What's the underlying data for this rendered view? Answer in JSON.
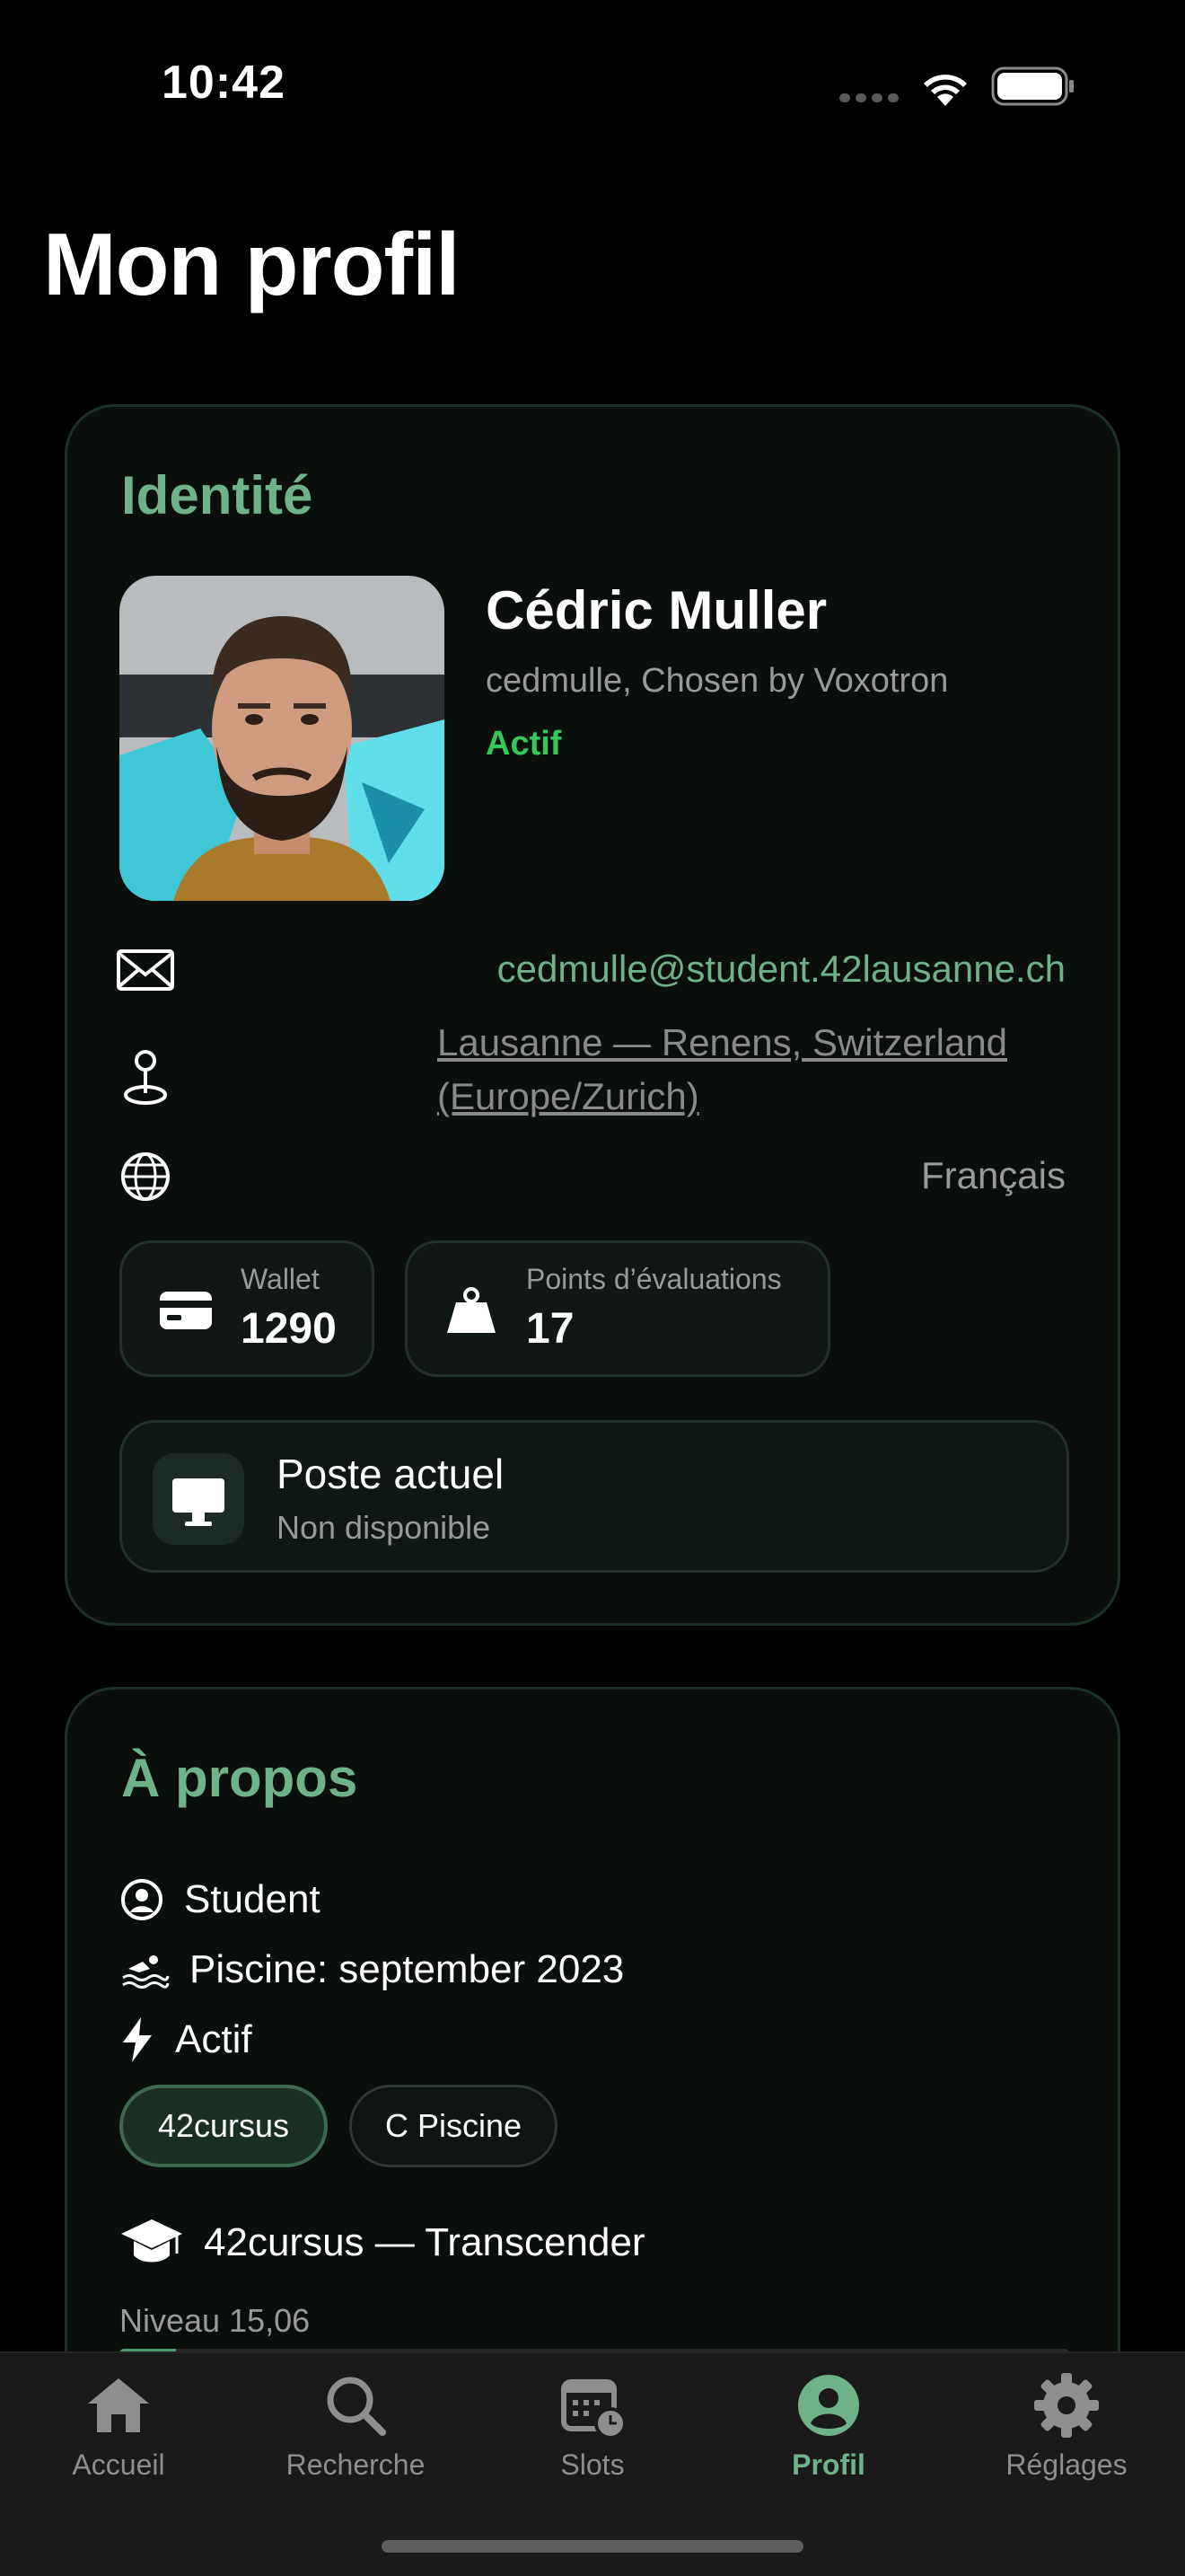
{
  "status_bar": {
    "time": "10:42"
  },
  "page": {
    "title": "Mon profil"
  },
  "identity": {
    "section_title": "Identité",
    "name": "Cédric Muller",
    "login_line": "cedmulle, Chosen by Voxotron",
    "status": "Actif",
    "email": "cedmulle@student.42lausanne.ch",
    "location": "Lausanne — Renens, Switzerland (Europe/Zurich)",
    "language": "Français",
    "wallet": {
      "label": "Wallet",
      "value": "1290"
    },
    "points": {
      "label": "Points d’évaluations",
      "value": "17"
    },
    "poste": {
      "title": "Poste actuel",
      "subtitle": "Non disponible"
    }
  },
  "about": {
    "section_title": "À propos",
    "kind": "Student",
    "piscine": "Piscine: september 2023",
    "activity": "Actif",
    "chips": [
      "42cursus",
      "C Piscine"
    ],
    "project": "42cursus — Transcender",
    "level_text": "Niveau 15,06",
    "level_progress": 0.06
  },
  "tabbar": {
    "tabs": [
      {
        "label": "Accueil",
        "icon": "house-icon"
      },
      {
        "label": "Recherche",
        "icon": "magnifying-glass-icon"
      },
      {
        "label": "Slots",
        "icon": "calendar-clock-icon"
      },
      {
        "label": "Profil",
        "icon": "person-circle-icon",
        "active": true
      },
      {
        "label": "Réglages",
        "icon": "gear-icon"
      }
    ]
  },
  "colors": {
    "accent": "#6fb188",
    "active": "#34c759",
    "background": "#000000",
    "card": "#0a0f0c"
  }
}
